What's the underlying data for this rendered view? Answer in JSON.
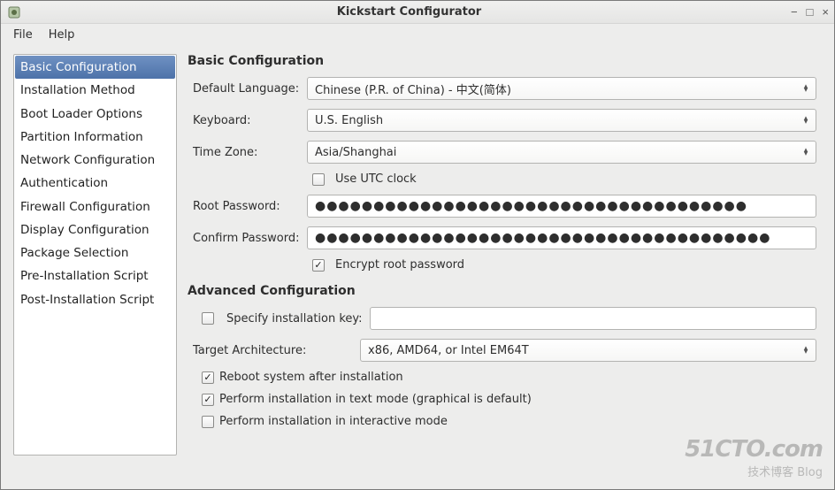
{
  "window": {
    "title": "Kickstart Configurator"
  },
  "menubar": {
    "file": "File",
    "help": "Help"
  },
  "sidebar": {
    "items": [
      {
        "label": "Basic Configuration",
        "selected": true
      },
      {
        "label": "Installation Method",
        "selected": false
      },
      {
        "label": "Boot Loader Options",
        "selected": false
      },
      {
        "label": "Partition Information",
        "selected": false
      },
      {
        "label": "Network Configuration",
        "selected": false
      },
      {
        "label": "Authentication",
        "selected": false
      },
      {
        "label": "Firewall Configuration",
        "selected": false
      },
      {
        "label": "Display Configuration",
        "selected": false
      },
      {
        "label": "Package Selection",
        "selected": false
      },
      {
        "label": "Pre-Installation Script",
        "selected": false
      },
      {
        "label": "Post-Installation Script",
        "selected": false
      }
    ]
  },
  "basic": {
    "heading": "Basic Configuration",
    "defaultLanguage": {
      "label": "Default Language:",
      "value": "Chinese (P.R. of China) - 中文(简体)"
    },
    "keyboard": {
      "label": "Keyboard:",
      "value": "U.S. English"
    },
    "timeZone": {
      "label": "Time Zone:",
      "value": "Asia/Shanghai"
    },
    "useUtc": {
      "label": "Use UTC clock",
      "checked": false
    },
    "rootPassword": {
      "label": "Root Password:",
      "masked": "●●●●●●●●●●●●●●●●●●●●●●●●●●●●●●●●●●●●●"
    },
    "confirmPassword": {
      "label": "Confirm Password:",
      "masked": "●●●●●●●●●●●●●●●●●●●●●●●●●●●●●●●●●●●●●●●"
    },
    "encryptRoot": {
      "label": "Encrypt root password",
      "checked": true
    }
  },
  "advanced": {
    "heading": "Advanced Configuration",
    "specifyKey": {
      "label": "Specify installation key:",
      "checked": false,
      "value": ""
    },
    "targetArch": {
      "label": "Target Architecture:",
      "value": "x86, AMD64, or Intel EM64T"
    },
    "reboot": {
      "label": "Reboot system after installation",
      "checked": true
    },
    "textMode": {
      "label": "Perform installation in text mode (graphical is default)",
      "checked": true
    },
    "interactive": {
      "label": "Perform installation in interactive mode",
      "checked": false
    }
  },
  "watermark": {
    "line1": "51CTO.com",
    "line2": "技术博客      Blog"
  }
}
